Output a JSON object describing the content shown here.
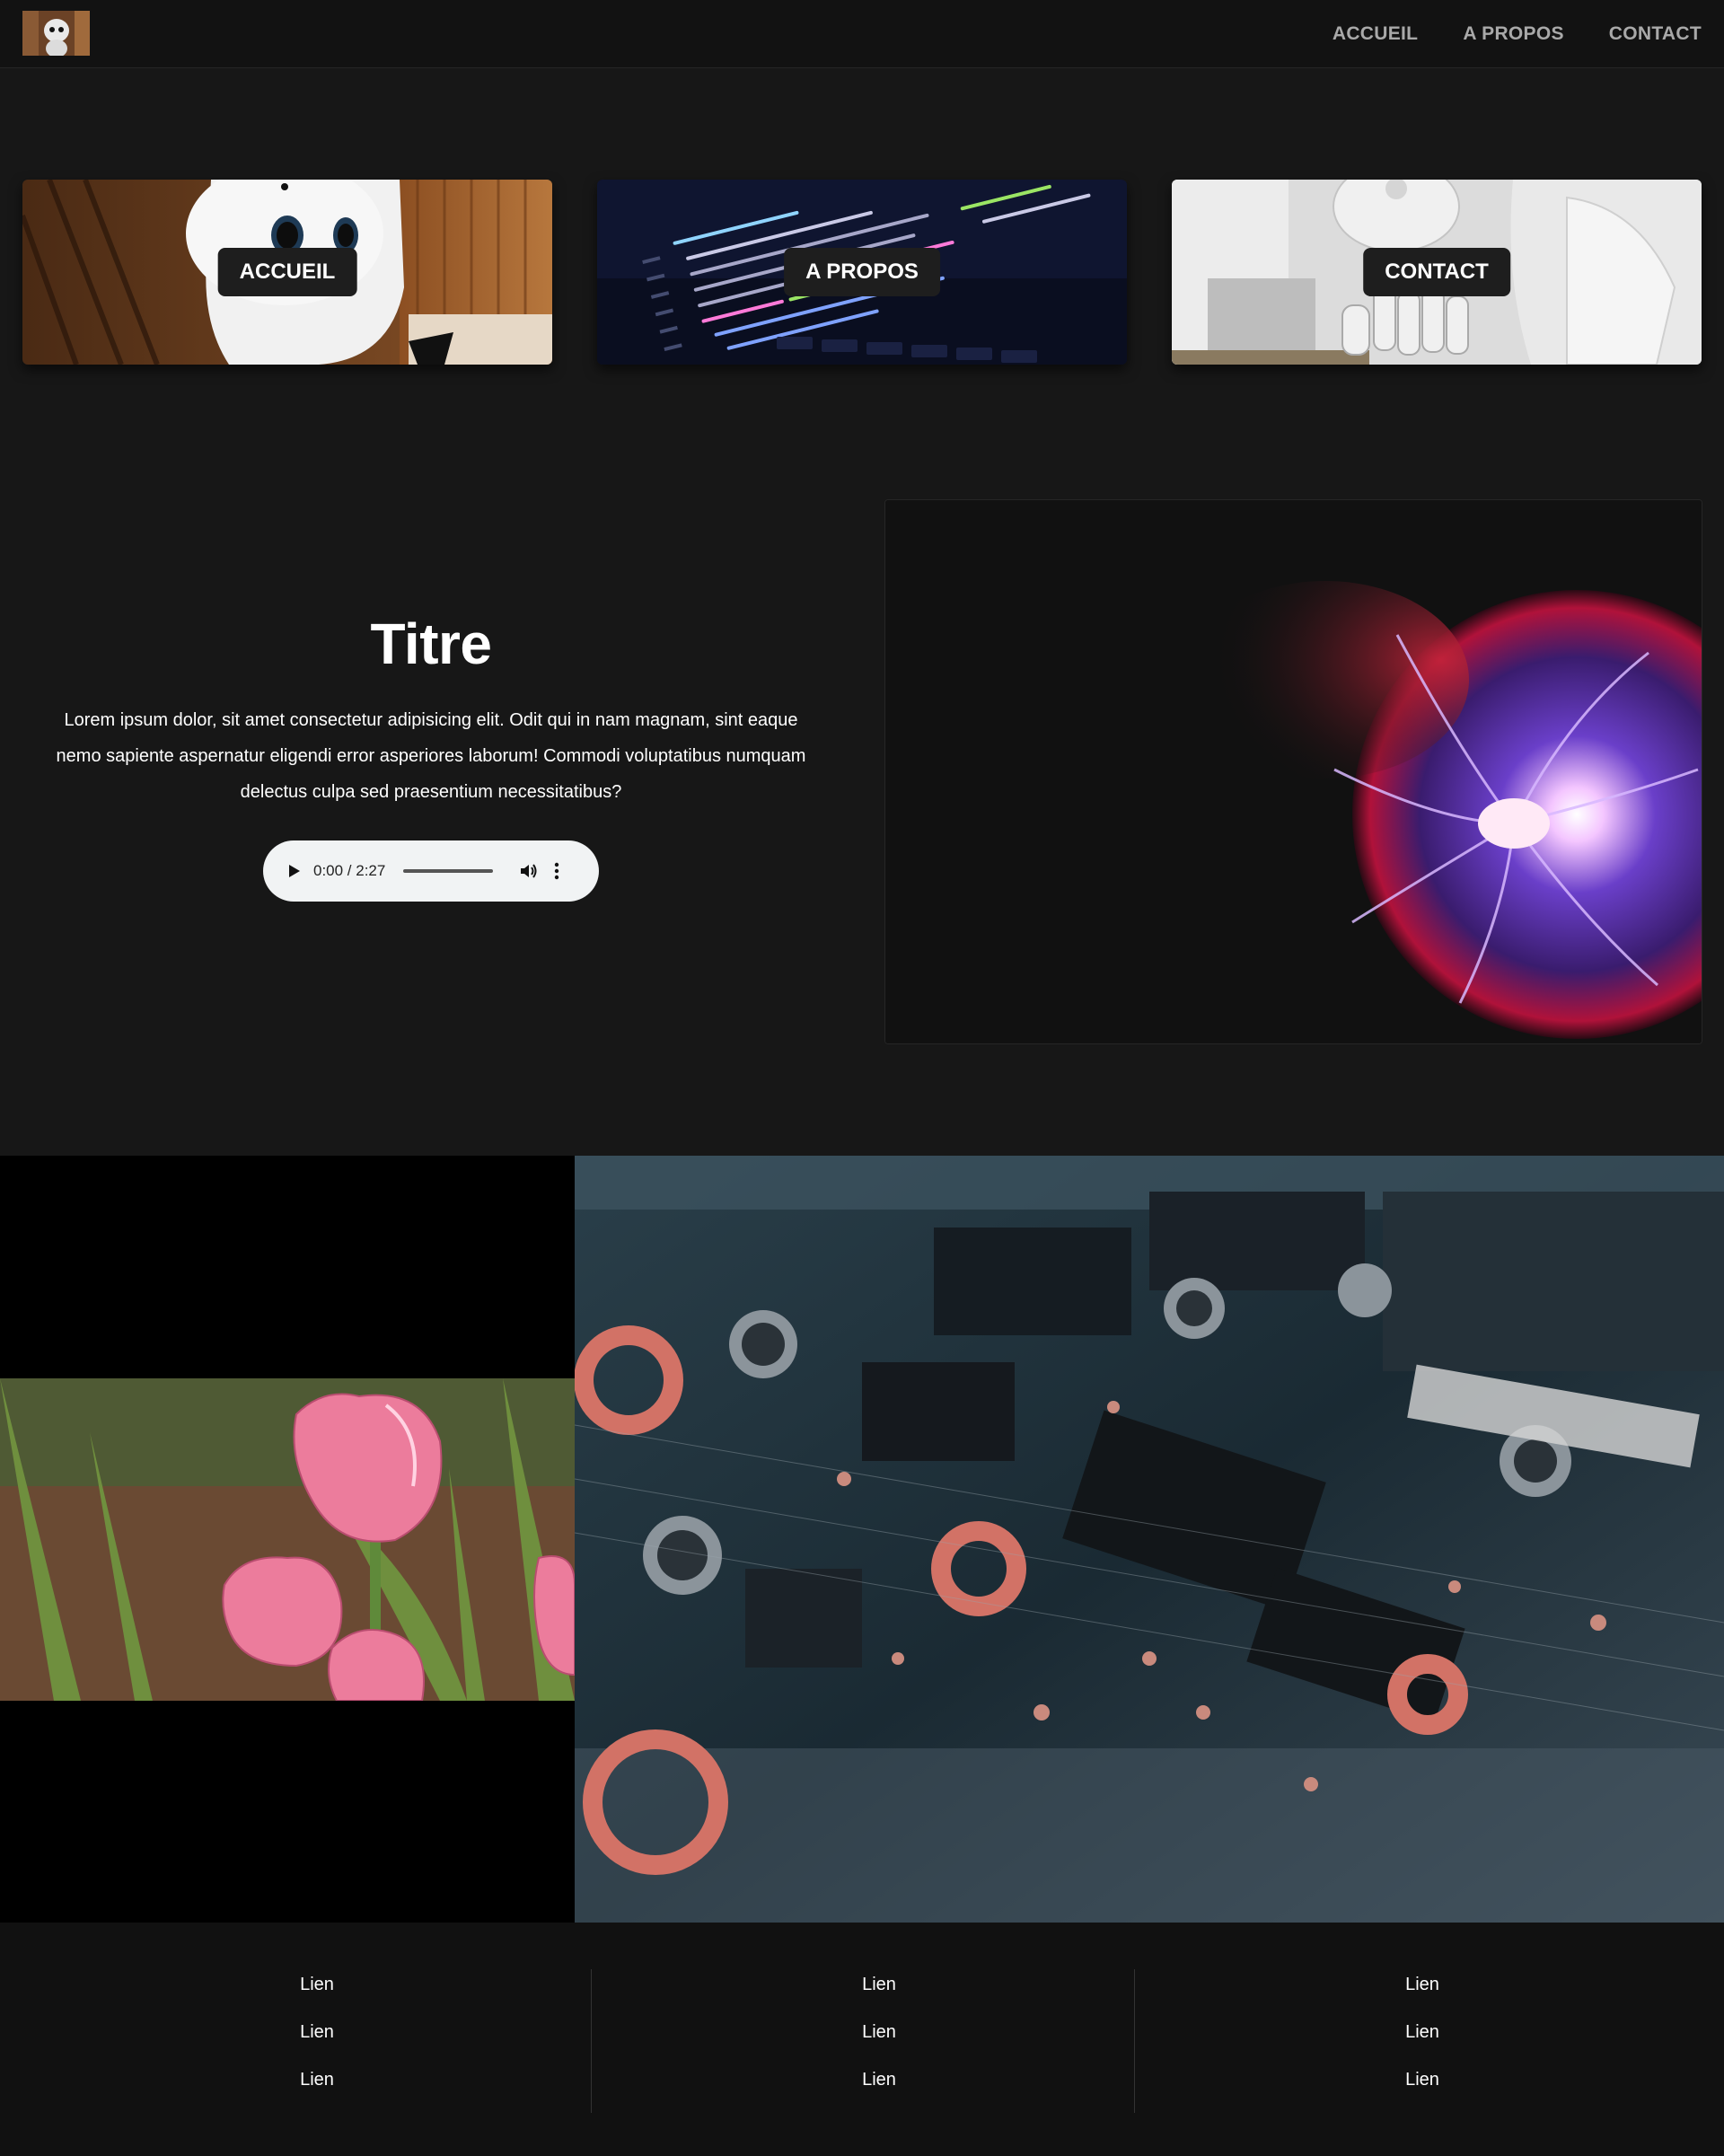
{
  "nav": {
    "logo_icon": "robot-logo-icon",
    "links": [
      "ACCUEIL",
      "A PROPOS",
      "CONTACT"
    ]
  },
  "cards": [
    {
      "label": "ACCUEIL",
      "image": "robot-pepper-image"
    },
    {
      "label": "A PROPOS",
      "image": "code-screen-image"
    },
    {
      "label": "CONTACT",
      "image": "robot-hand-image"
    }
  ],
  "hero": {
    "title": "Titre",
    "paragraph": "Lorem ipsum dolor, sit amet consectetur adipisicing elit. Odit qui in nam magnam, sint eaque nemo sapiente aspernatur eligendi error asperiores laborum! Commodi voluptatibus numquam delectus culpa sed praesentium necessitatibus?",
    "audio": {
      "time": "0:00 / 2:27"
    },
    "image": "plasma-ball-image"
  },
  "gallery": {
    "left_image": "pink-tulips-image",
    "right_image": "circuit-board-image"
  },
  "footer": {
    "columns": [
      [
        "Lien",
        "Lien",
        "Lien"
      ],
      [
        "Lien",
        "Lien",
        "Lien"
      ],
      [
        "Lien",
        "Lien",
        "Lien"
      ]
    ]
  },
  "colors": {
    "background": "#171717",
    "navbar": "#121212",
    "nav_link": "#a9a9a9",
    "footer": "#111111",
    "audio_player": "#f1f3f4"
  }
}
